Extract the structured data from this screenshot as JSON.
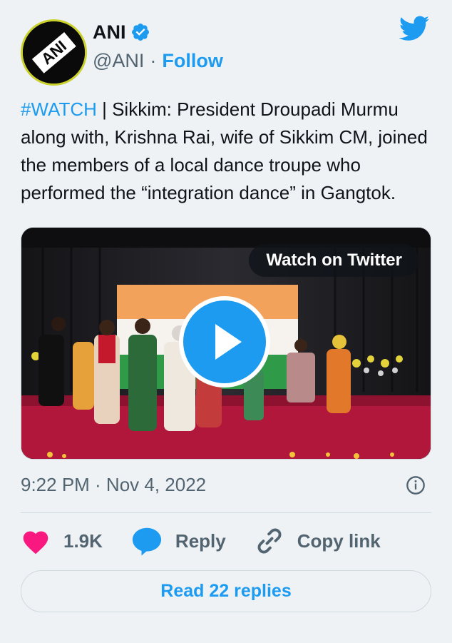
{
  "author": {
    "name": "ANI",
    "handle": "@ANI",
    "follow_label": "Follow",
    "separator": "·",
    "avatar_text": "ANI"
  },
  "tweet": {
    "hashtag": "#WATCH",
    "body": " | Sikkim: President Droupadi Murmu along with, Krishna Rai, wife of Sikkim CM, joined the members of a local dance troupe who performed the “integration dance” in Gangtok."
  },
  "media": {
    "watch_label": "Watch on Twitter"
  },
  "meta": {
    "timestamp": "9:22 PM · Nov 4, 2022"
  },
  "actions": {
    "likes": "1.9K",
    "reply_label": "Reply",
    "copy_label": "Copy link",
    "read_replies": "Read 22 replies"
  },
  "colors": {
    "accent": "#1d9bf0",
    "like": "#f91880",
    "background": "#eef2f5"
  }
}
